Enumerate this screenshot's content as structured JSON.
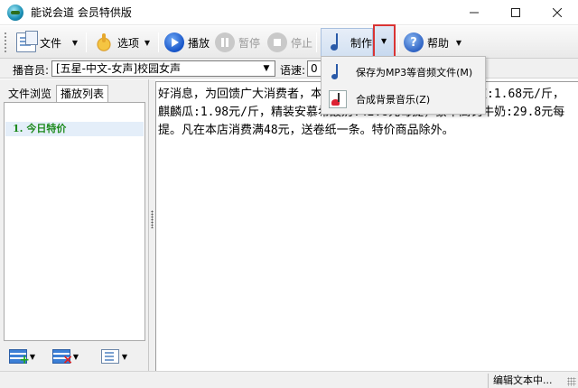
{
  "window": {
    "title": "能说会道 会员特供版"
  },
  "toolbar": {
    "file_label": "文件",
    "options_label": "选项",
    "play_label": "播放",
    "pause_label": "暂停",
    "stop_label": "停止",
    "make_label": "制作",
    "help_label": "帮助"
  },
  "voice": {
    "label": "播音员:",
    "selected": "[五星-中文-女声]校园女声",
    "speed_label": "语速:",
    "speed_value": "0"
  },
  "left_panel": {
    "tabs": [
      {
        "label": "文件浏览",
        "active": false
      },
      {
        "label": "播放列表",
        "active": true
      }
    ],
    "items": [
      {
        "label": "1. 今日特价"
      }
    ]
  },
  "editor": {
    "text": "好消息，为回馈广大消费者，本店特推出以下特价商品：小青椒:1.68元/斤，麒麟瓜:1.98元/斤，精装安慕希酸奶:42.8元每提，蒙牛高钙牛奶:29.8元每提。凡在本店消费满48元，送卷纸一条。特价商品除外。"
  },
  "menu": {
    "items": [
      {
        "label": "保存为MP3等音频文件(M)"
      },
      {
        "label": "合成背景音乐(Z)"
      }
    ]
  },
  "status": {
    "text": "编辑文本中..."
  },
  "colors": {
    "accent_red": "#d93434",
    "list_text_green": "#1d8a1d"
  }
}
